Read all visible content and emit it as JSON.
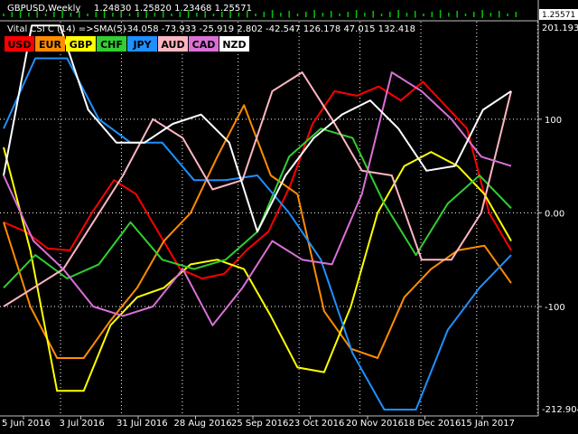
{
  "price_panel": {
    "title": "GBPUSD,Weekly",
    "ohlc": "1.24830 1.25820 1.23468 1.25571",
    "price_tag": "1.25571"
  },
  "indicator": {
    "title": "Vital CSI C (14) =>SMA(5)",
    "values": "-34.058 -73.933 -25.919 2.802 -42.547 126.178 47.015 132.418",
    "max_label": "201.193",
    "min_label": "-212.904"
  },
  "currencies": [
    {
      "name": "USD",
      "color": "#ff0000",
      "text_color": "#000000"
    },
    {
      "name": "EUR",
      "color": "#ff8c00",
      "text_color": "#000000"
    },
    {
      "name": "GBP",
      "color": "#ffff00",
      "text_color": "#000000"
    },
    {
      "name": "CHF",
      "color": "#32cd32",
      "text_color": "#000000"
    },
    {
      "name": "JPY",
      "color": "#1e90ff",
      "text_color": "#000000"
    },
    {
      "name": "AUD",
      "color": "#ffb6c1",
      "text_color": "#000000"
    },
    {
      "name": "CAD",
      "color": "#da70d6",
      "text_color": "#000000"
    },
    {
      "name": "NZD",
      "color": "#ffffff",
      "text_color": "#000000"
    }
  ],
  "chart_data": {
    "type": "line",
    "x": [
      0,
      1,
      2,
      3,
      4,
      5,
      6,
      7,
      8,
      9,
      10,
      11,
      12,
      13,
      14,
      15,
      16,
      17,
      18,
      19,
      20,
      21,
      22,
      23,
      24,
      25,
      26,
      27,
      28,
      29,
      30,
      31,
      32,
      33,
      34,
      35,
      36,
      37,
      38,
      39,
      40,
      41,
      42,
      43,
      44,
      45,
      46,
      47,
      48,
      49,
      50,
      51,
      52,
      53,
      54,
      55,
      56,
      57,
      58,
      59,
      60,
      61,
      62,
      63,
      64,
      65,
      66,
      67,
      68,
      69,
      70,
      71,
      72,
      73,
      74,
      75,
      76,
      77,
      78,
      79,
      80,
      81,
      82,
      83,
      84,
      85,
      86,
      87,
      88,
      89,
      90,
      91,
      92,
      93,
      94,
      95,
      96,
      97,
      98,
      99,
      100
    ],
    "x_tick_labels": [
      {
        "index": 0,
        "label": "5 Jun 2016"
      },
      {
        "index": 4,
        "label": "3 Jul 2016"
      },
      {
        "index": 8,
        "label": "31 Jul 2016"
      },
      {
        "index": 12,
        "label": "28 Aug 2016"
      },
      {
        "index": 16,
        "label": "25 Sep 2016"
      },
      {
        "index": 20,
        "label": "23 Oct 2016"
      },
      {
        "index": 24,
        "label": "20 Nov 2016"
      },
      {
        "index": 28,
        "label": "18 Dec 2016"
      },
      {
        "index": 32,
        "label": "15 Jan 2017"
      }
    ],
    "y_tick_labels": [
      100,
      0.0,
      -100
    ],
    "y_tick_text": [
      "100",
      "0.00",
      "-100"
    ],
    "ylim": [
      -212.904,
      201.193
    ],
    "grid": true,
    "series": [
      {
        "name": "USD",
        "color": "#ff0000",
        "values": [
          -10,
          -20,
          -38,
          -40,
          0,
          35,
          20,
          -20,
          -60,
          -70,
          -65,
          -40,
          -20,
          30,
          95,
          130,
          125,
          135,
          120,
          140,
          115,
          90,
          0,
          -40
        ]
      },
      {
        "name": "EUR",
        "color": "#ff8c00",
        "values": [
          -10,
          -100,
          -155,
          -155,
          -115,
          -80,
          -30,
          0,
          60,
          115,
          40,
          20,
          -105,
          -145,
          -155,
          -90,
          -60,
          -40,
          -35,
          -75
        ]
      },
      {
        "name": "GBP",
        "color": "#ffff00",
        "values": [
          70,
          -40,
          -190,
          -190,
          -120,
          -90,
          -80,
          -55,
          -50,
          -60,
          -110,
          -165,
          -170,
          -100,
          0,
          50,
          65,
          50,
          20,
          -30
        ]
      },
      {
        "name": "CHF",
        "color": "#32cd32",
        "values": [
          -80,
          -45,
          -70,
          -55,
          -10,
          -50,
          -60,
          -50,
          -20,
          60,
          90,
          80,
          10,
          -45,
          10,
          40,
          5
        ]
      },
      {
        "name": "JPY",
        "color": "#1e90ff",
        "values": [
          90,
          165,
          165,
          100,
          75,
          75,
          35,
          35,
          40,
          0,
          -50,
          -150,
          -210,
          -210,
          -125,
          -80,
          -45
        ]
      },
      {
        "name": "AUD",
        "color": "#ffb6c1",
        "values": [
          -100,
          -80,
          -60,
          -10,
          40,
          100,
          80,
          25,
          35,
          130,
          150,
          100,
          45,
          40,
          -50,
          -50,
          0,
          130
        ]
      },
      {
        "name": "CAD",
        "color": "#da70d6",
        "values": [
          40,
          -30,
          -60,
          -100,
          -110,
          -100,
          -60,
          -120,
          -80,
          -30,
          -50,
          -55,
          20,
          150,
          130,
          100,
          60,
          50
        ]
      },
      {
        "name": "NZD",
        "color": "#ffffff",
        "values": [
          40,
          200,
          200,
          110,
          75,
          75,
          95,
          105,
          75,
          -20,
          40,
          80,
          105,
          120,
          90,
          45,
          50,
          110,
          130
        ]
      }
    ]
  }
}
